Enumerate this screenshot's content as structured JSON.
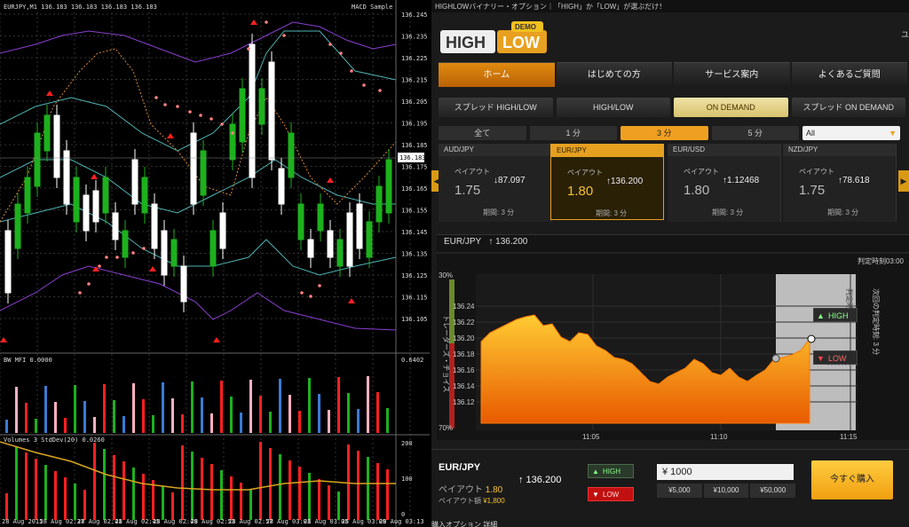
{
  "mt4": {
    "header": "EURJPY,M1  136.183 136.183 136.183 136.183",
    "indicator": "MACD Sample",
    "price_labels": [
      "136.245",
      "136.235",
      "136.225",
      "136.215",
      "136.205",
      "136.195",
      "136.185",
      "136.175",
      "136.165",
      "136.155",
      "136.145",
      "136.135",
      "136.125",
      "136.115",
      "136.105"
    ],
    "current_price": "136.183",
    "sub1_label": "BW MFI 0.0000",
    "sub1_value": "0.6402",
    "sub2_label": "Volumes 3  StdDev(20) 0.0260",
    "sub2_scale": [
      "200",
      "100",
      "0"
    ],
    "time_labels": [
      "28 Aug 2015",
      "28 Aug 02:37",
      "28 Aug 02:41",
      "28 Aug 02:45",
      "28 Aug 02:49",
      "28 Aug 02:53",
      "28 Aug 02:57",
      "28 Aug 03:01",
      "28 Aug 03:05",
      "28 Aug 03:09",
      "28 Aug 03:13"
    ],
    "colors": {
      "bull": "#1db11d",
      "bear": "#ffffff",
      "purple": "#8a3fd0",
      "cyan": "#4fb3b3",
      "orange": "#d98a3a",
      "red": "#ff2020",
      "pink": "#ff8080"
    }
  },
  "hl": {
    "topline": "HIGHLOWバイナリー・オプション｜「HIGH」か「LOW」が選ぶだけ！",
    "logo": {
      "word1": "HIGH",
      "word2": "LOW",
      "badge": "DEMO"
    },
    "user": "ユ",
    "nav": [
      "ホーム",
      "はじめての方",
      "サービス案内",
      "よくあるご質問"
    ],
    "modes": [
      "スプレッド HIGH/LOW",
      "HIGH/LOW",
      "ON DEMAND",
      "スプレッド ON DEMAND"
    ],
    "durations": [
      "全て",
      "1 分",
      "3 分",
      "5 分"
    ],
    "select": "All",
    "cards": [
      {
        "sym": "AUD/JPY",
        "label": "ペイアウト",
        "payout": "1.75",
        "rate": "↓87.097",
        "period": "期間: 3 分"
      },
      {
        "sym": "EUR/JPY",
        "label": "ペイアウト",
        "payout": "1.80",
        "rate": "↑136.200",
        "period": "期間: 3 分"
      },
      {
        "sym": "EUR/USD",
        "label": "ペイアウト",
        "payout": "1.80",
        "rate": "↑1.12468",
        "period": "期間: 3 分"
      },
      {
        "sym": "NZD/JPY",
        "label": "ペイアウト",
        "payout": "1.75",
        "rate": "↑78.618",
        "period": "期間: 3 分"
      }
    ],
    "chart": {
      "symbol": "EUR/JPY",
      "rate": "↑ 136.200",
      "judge": "判定時刻03:00",
      "top_pct": "30%",
      "bottom_pct": "70%",
      "side_text": "トレーダーズ・チョイス",
      "right_text1": "判定時刻",
      "right_text2": "次回の判定時刻: 3 分",
      "high": "HIGH",
      "low": "LOW",
      "y_ticks": [
        "136.24",
        "136.22",
        "136.20",
        "136.18",
        "136.16",
        "136.14",
        "136.12"
      ],
      "x_ticks": [
        "11:05",
        "11:10",
        "11:15"
      ]
    },
    "bottom": {
      "symbol": "EUR/JPY",
      "rate": "↑ 136.200",
      "payout_label": "ペイアウト",
      "payout": "1.80",
      "amount_label": "ペイアウト額",
      "amount": "¥1,800",
      "high": "HIGH",
      "low": "LOW",
      "input": "¥ 1000",
      "presets": [
        "¥5,000",
        "¥10,000",
        "¥50,000"
      ],
      "buy": "今すぐ購入",
      "footer": "購入オプション 詳細"
    }
  }
}
